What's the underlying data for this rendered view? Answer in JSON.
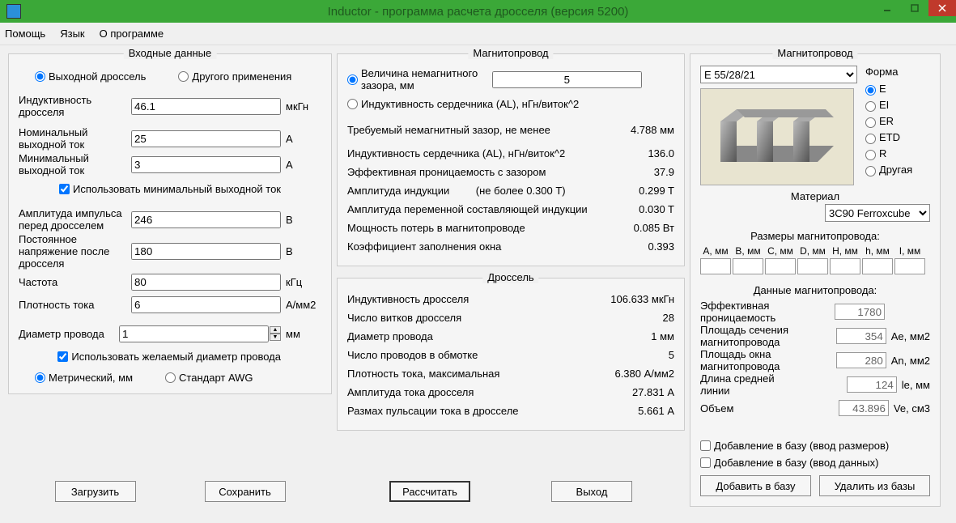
{
  "title": "Inductor - программа расчета дросселя (версия 5200)",
  "menu": {
    "help": "Помощь",
    "lang": "Язык",
    "about": "О программе"
  },
  "input": {
    "legend": "Входные данные",
    "type_radio": {
      "output": "Выходной дроссель",
      "other": "Другого применения"
    },
    "inductance_lbl": "Индуктивность дросселя",
    "inductance_val": "46.1",
    "inductance_unit": "мкГн",
    "inom_lbl": "Номинальный выходной ток",
    "inom_val": "25",
    "inom_unit": "А",
    "imin_lbl": "Минимальный выходной ток",
    "imin_val": "3",
    "imin_unit": "А",
    "use_imin": "Использовать минимальный выходной ток",
    "pulse_lbl": "Амплитуда импульса перед дросселем",
    "pulse_val": "246",
    "pulse_unit": "В",
    "vdc_lbl": "Постоянное напряжение после дросселя",
    "vdc_val": "180",
    "vdc_unit": "В",
    "freq_lbl": "Частота",
    "freq_val": "80",
    "freq_unit": "кГц",
    "j_lbl": "Плотность тока",
    "j_val": "6",
    "j_unit": "А/мм2",
    "dwire_lbl": "Диаметр провода",
    "dwire_val": "1",
    "dwire_unit": "мм",
    "use_dwire": "Использовать желаемый диаметр провода",
    "metric": "Метрический, мм",
    "awg": "Стандарт AWG",
    "load": "Загрузить",
    "save": "Сохранить"
  },
  "core_calc": {
    "legend": "Магнитопровод",
    "gap_radio": "Величина немагнитного зазора, мм",
    "gap_val": "5",
    "al_radio": "Индуктивность сердечника (AL), нГн/виток^2",
    "r1_lbl": "Требуемый немагнитный зазор, не менее",
    "r1_val": "4.788 мм",
    "r2_lbl": "Индуктивность сердечника (AL), нГн/виток^2",
    "r2_val": "136.0",
    "r3_lbl": "Эффективная проницаемость с зазором",
    "r3_val": "37.9",
    "r4_lbl": "Амплитуда индукции",
    "r4_note": "(не более 0.300 T)",
    "r4_val": "0.299 T",
    "r5_lbl": "Амплитуда переменной составляющей индукции",
    "r5_val": "0.030 T",
    "r6_lbl": "Мощность потерь в магнитопроводе",
    "r6_val": "0.085 Вт",
    "r7_lbl": "Коэффициент заполнения окна",
    "r7_val": "0.393"
  },
  "inductor": {
    "legend": "Дроссель",
    "r1_lbl": "Индуктивность дросселя",
    "r1_val": "106.633 мкГн",
    "r2_lbl": "Число витков дросселя",
    "r2_val": "28",
    "r3_lbl": "Диаметр провода",
    "r3_val": "1 мм",
    "r4_lbl": "Число проводов в обмотке",
    "r4_val": "5",
    "r5_lbl": "Плотность тока, максимальная",
    "r5_val": "6.380 А/мм2",
    "r6_lbl": "Амплитуда тока дросселя",
    "r6_val": "27.831 А",
    "r7_lbl": "Размах пульсации тока в дросселе",
    "r7_val": "5.661 А"
  },
  "btns": {
    "calc": "Рассчитать",
    "exit": "Выход"
  },
  "core_sel": {
    "legend": "Магнитопровод",
    "select_core": "E 55/28/21",
    "shape_lbl": "Форма",
    "shapes": [
      "E",
      "EI",
      "ER",
      "ETD",
      "R",
      "Другая"
    ],
    "material_lbl": "Материал",
    "material": "3C90 Ferroxcube",
    "dim_title": "Размеры магнитопровода:",
    "dim_heads": [
      "A, мм",
      "B, мм",
      "C, мм",
      "D, мм",
      "H, мм",
      "h, мм",
      "I, мм"
    ],
    "data_title": "Данные магнитопровода:",
    "mu_lbl": "Эффективная проницаемость",
    "mu_val": "1780",
    "ae_lbl": "Площадь сечения магнитопровода",
    "ae_val": "354",
    "ae_unit": "Ae, мм2",
    "an_lbl": "Площадь окна магнитопровода",
    "an_val": "280",
    "an_unit": "An, мм2",
    "le_lbl": "Длина средней линии",
    "le_val": "124",
    "le_unit": "le, мм",
    "ve_lbl": "Объем",
    "ve_val": "43.896",
    "ve_unit": "Ve, см3",
    "add_dim_chk": "Добавление в базу (ввод размеров)",
    "add_data_chk": "Добавление в базу (ввод данных)",
    "add_btn": "Добавить в базу",
    "del_btn": "Удалить из базы"
  }
}
